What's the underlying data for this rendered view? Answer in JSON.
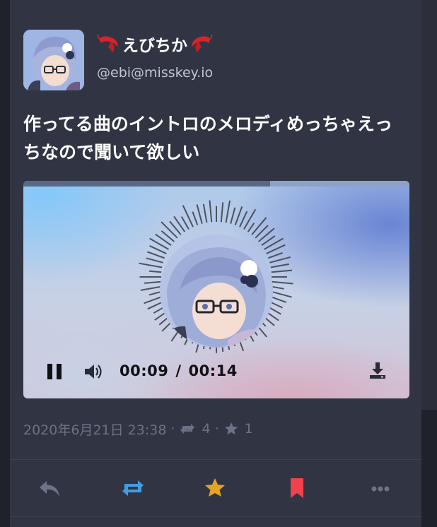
{
  "author": {
    "display_name": "えびちか",
    "name_emoji": "shrimp-emoji",
    "handle": "@ebi@misskey.io",
    "avatar_icon": "avatar-anime-girl-glasses"
  },
  "post": {
    "text": "作ってる曲のイントロのメロディめっちゃえっちなので聞いて欲しい"
  },
  "player": {
    "current_time": "00:09",
    "separator": "/",
    "duration": "00:14",
    "progress_fraction": 0.64,
    "state": "playing",
    "icons": [
      "pause-icon",
      "volume-icon",
      "download-icon"
    ]
  },
  "meta": {
    "timestamp": "2020年6月21日 23:38",
    "dot": "·",
    "renote_count": "4",
    "reaction_count": "1"
  },
  "actions": [
    "reply-icon",
    "renote-icon",
    "favorite-star-icon",
    "bookmark-icon",
    "more-icon"
  ],
  "colors": {
    "background": "#313543",
    "renote": "#3f9ee6",
    "favorite": "#e5a424",
    "bookmark": "#f0424a",
    "muted": "#6c7186"
  }
}
